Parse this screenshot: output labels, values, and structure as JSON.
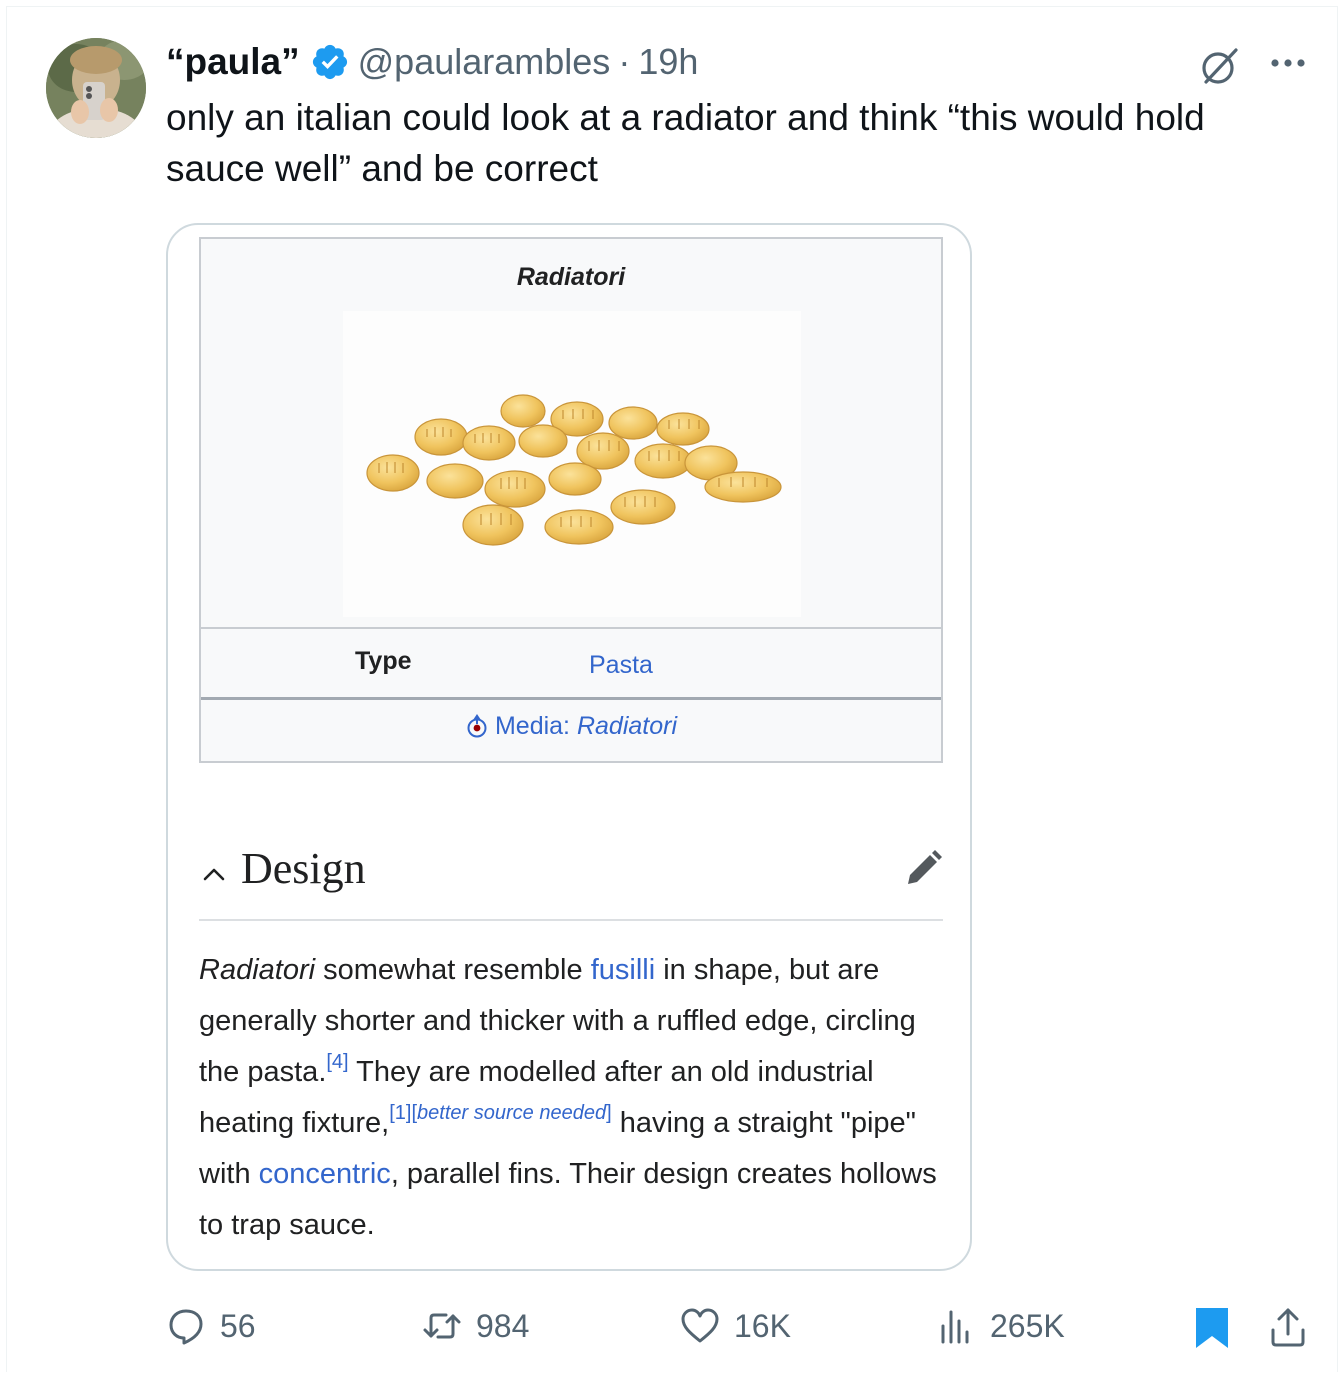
{
  "tweet": {
    "display_name": "“paula”",
    "handle": "@paularambles",
    "separator": "·",
    "time": "19h",
    "text": "only an italian could look at a radiator and think “this would hold sauce well” and be correct"
  },
  "card": {
    "infobox": {
      "title": "Radiatori",
      "type_label": "Type",
      "type_value": "Pasta",
      "media_prefix": "Media:",
      "media_value": "Radiatori"
    },
    "section": {
      "title": "Design",
      "p1_italic": "Radiatori",
      "p1a": " somewhat resemble ",
      "link_fusilli": "fusilli",
      "p1b": " in shape, but are generally shorter and thicker with a ruffled edge, circling the pasta.",
      "ref4": "[4]",
      "p1c": " They are modelled after an old industrial heating fixture,",
      "ref1": "[1]",
      "ref_bsn_open": "[",
      "ref_bsn": "better source needed",
      "ref_bsn_close": "]",
      "p1d": " having a straight \"pipe\" with ",
      "link_concentric": "concentric",
      "p1e": ", parallel fins. Their design creates hollows to trap sauce."
    }
  },
  "actions": {
    "replies": "56",
    "retweets": "984",
    "likes": "16K",
    "views": "265K"
  },
  "icons": [
    "verified-icon",
    "grok-icon",
    "more-icon",
    "chevron-up-icon",
    "pencil-icon",
    "commons-icon",
    "reply-icon",
    "retweet-icon",
    "like-icon",
    "views-icon",
    "bookmark-icon",
    "share-icon"
  ],
  "colors": {
    "verified": "#1d9bf0",
    "wiki_link": "#3366cc",
    "secondary_text": "#536471",
    "bookmark_active": "#1d9bf0"
  }
}
